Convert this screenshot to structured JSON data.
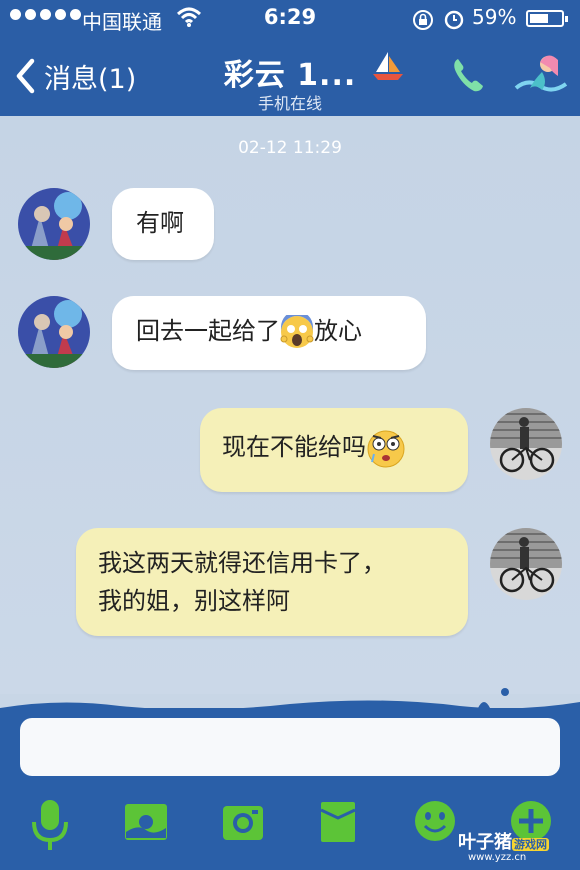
{
  "status_bar": {
    "carrier": "中国联通",
    "time": "6:29",
    "battery_percent": "59%",
    "battery_level": 0.59
  },
  "nav": {
    "back_label": "消息(1)",
    "title": "彩云 1...",
    "subtitle": "手机在线"
  },
  "chat": {
    "timestamp": "02-12 11:29",
    "messages": [
      {
        "direction": "in",
        "text": "有啊"
      },
      {
        "direction": "in",
        "text_before": "回去一起给了",
        "emoji": "fear-emoji",
        "text_after": "放心"
      },
      {
        "direction": "out",
        "text": "现在不能给吗",
        "emoji": "shocked-emoji"
      },
      {
        "direction": "out",
        "line1": "我这两天就得还信用卡了，",
        "line2": "我的姐，别这样阿"
      }
    ]
  },
  "input": {
    "placeholder": ""
  },
  "toolbar": {
    "icons": [
      "microphone-icon",
      "image-icon",
      "camera-icon",
      "folder-icon",
      "smiley-icon",
      "plus-icon"
    ]
  },
  "watermark": {
    "brand_a": "叶子猪",
    "brand_b": "游戏网",
    "url": "www.yzz.cn"
  },
  "colors": {
    "nav_bg": "#2b5ea6",
    "chat_bg": "#c8d6e6",
    "incoming_bubble": "#ffffff",
    "outgoing_bubble": "#f5f0b8",
    "toolbar_green": "#5cc437"
  }
}
